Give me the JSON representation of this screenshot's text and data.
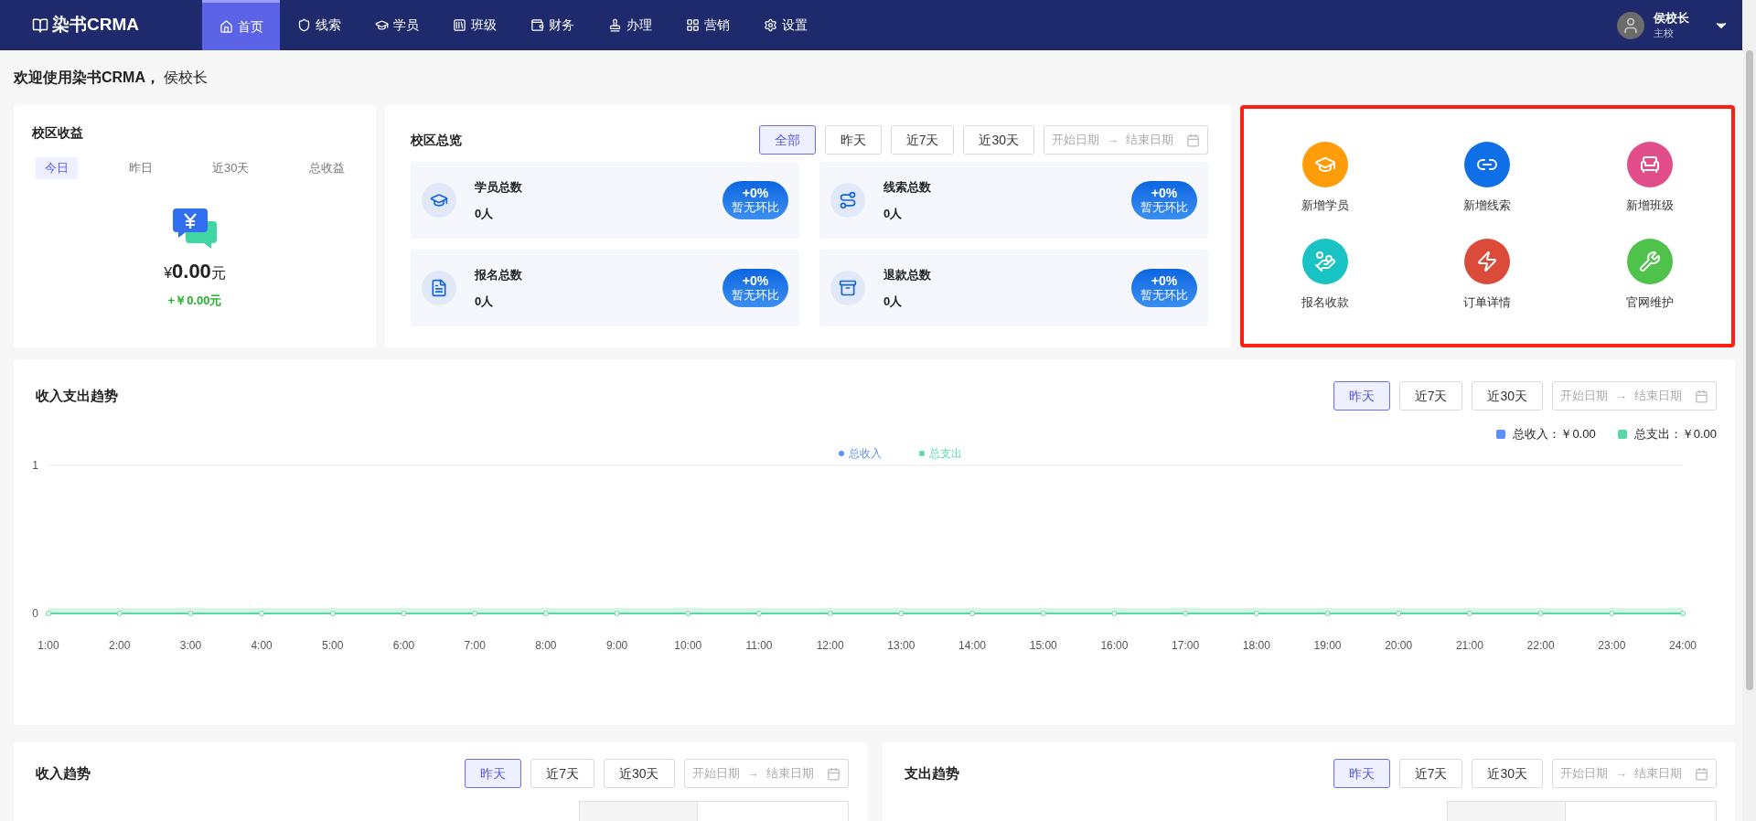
{
  "nav": {
    "logo": "染书CRMA",
    "items": [
      {
        "label": "首页",
        "selected": true
      },
      {
        "label": "线索",
        "selected": false
      },
      {
        "label": "学员",
        "selected": false
      },
      {
        "label": "班级",
        "selected": false
      },
      {
        "label": "财务",
        "selected": false
      },
      {
        "label": "办理",
        "selected": false
      },
      {
        "label": "营销",
        "selected": false
      },
      {
        "label": "设置",
        "selected": false
      }
    ],
    "user": {
      "name": "侯校长",
      "role": "主校"
    }
  },
  "welcome": "**欢迎使用染书CRMA，** 侯校长",
  "revenue_card": {
    "title": "校区收益",
    "tabs": [
      {
        "label": "今日",
        "selected": true
      },
      {
        "label": "昨日",
        "selected": false
      },
      {
        "label": "近30天",
        "selected": false
      },
      {
        "label": "总收益",
        "selected": false
      }
    ],
    "currency": "¥",
    "amount": "0.00",
    "unit": "元",
    "change": "+￥0.00元"
  },
  "overview_card": {
    "title": "校区总览",
    "filters": [
      {
        "label": "全部",
        "selected": true
      },
      {
        "label": "昨天",
        "selected": false
      },
      {
        "label": "近7天",
        "selected": false
      },
      {
        "label": "近30天",
        "selected": false
      }
    ],
    "date_range": {
      "start_placeholder": "开始日期",
      "separator": "→",
      "end_placeholder": "结束日期"
    },
    "stats": [
      {
        "label": "学员总数",
        "value": "0人",
        "change": "+0%",
        "note": "暂无环比"
      },
      {
        "label": "线索总数",
        "value": "0人",
        "change": "+0%",
        "note": "暂无环比"
      },
      {
        "label": "报名总数",
        "value": "0人",
        "change": "+0%",
        "note": "暂无环比"
      },
      {
        "label": "退款总数",
        "value": "0人",
        "change": "+0%",
        "note": "暂无环比"
      }
    ]
  },
  "quick_actions": [
    "新增学员",
    "新增线索",
    "新增班级",
    "报名收款",
    "订单详情",
    "官网维护"
  ],
  "trend_card": {
    "title": "收入支出趋势",
    "filters": [
      {
        "label": "昨天",
        "selected": true
      },
      {
        "label": "近7天",
        "selected": false
      },
      {
        "label": "近30天",
        "selected": false
      }
    ],
    "date_range": {
      "start_placeholder": "开始日期",
      "separator": "→",
      "end_placeholder": "结束日期"
    },
    "summary": [
      {
        "label": "总收入：",
        "value": "￥0.00",
        "color": "#5b8ff9"
      },
      {
        "label": "总支出：",
        "value": "￥0.00",
        "color": "#5ad8a6"
      }
    ],
    "chart_data": {
      "type": "line",
      "categories": [
        "1:00",
        "2:00",
        "3:00",
        "4:00",
        "5:00",
        "6:00",
        "7:00",
        "8:00",
        "9:00",
        "10:00",
        "11:00",
        "12:00",
        "13:00",
        "14:00",
        "15:00",
        "16:00",
        "17:00",
        "18:00",
        "19:00",
        "20:00",
        "21:00",
        "22:00",
        "23:00",
        "24:00"
      ],
      "series": [
        {
          "name": "总收入",
          "color": "#5b8ff9",
          "marker": "circle",
          "values": [
            null,
            null,
            null,
            null,
            null,
            null,
            null,
            null,
            null,
            null,
            null,
            null,
            null,
            null,
            null,
            null,
            null,
            null,
            null,
            null,
            null,
            null,
            null,
            null
          ]
        },
        {
          "name": "总支出",
          "color": "#5ad8a6",
          "marker": "circle",
          "values": [
            0,
            0,
            0,
            0,
            0,
            0,
            0,
            0,
            0,
            0,
            0,
            0,
            0,
            0,
            0,
            0,
            0,
            0,
            0,
            0,
            0,
            0,
            0,
            0
          ]
        }
      ],
      "legend": true,
      "ylim": [
        0,
        1
      ],
      "yticks": [
        0,
        1
      ]
    }
  },
  "bottom_cards": [
    {
      "title": "收入趋势",
      "filters": [
        {
          "label": "昨天",
          "selected": true
        },
        {
          "label": "近7天",
          "selected": false
        },
        {
          "label": "近30天",
          "selected": false
        }
      ],
      "date_range": {
        "start_placeholder": "开始日期",
        "separator": "→",
        "end_placeholder": "结束日期"
      }
    },
    {
      "title": "支出趋势",
      "filters": [
        {
          "label": "昨天",
          "selected": true
        },
        {
          "label": "近7天",
          "selected": false
        },
        {
          "label": "近30天",
          "selected": false
        }
      ],
      "date_range": {
        "start_placeholder": "开始日期",
        "separator": "→",
        "end_placeholder": "结束日期"
      }
    }
  ]
}
